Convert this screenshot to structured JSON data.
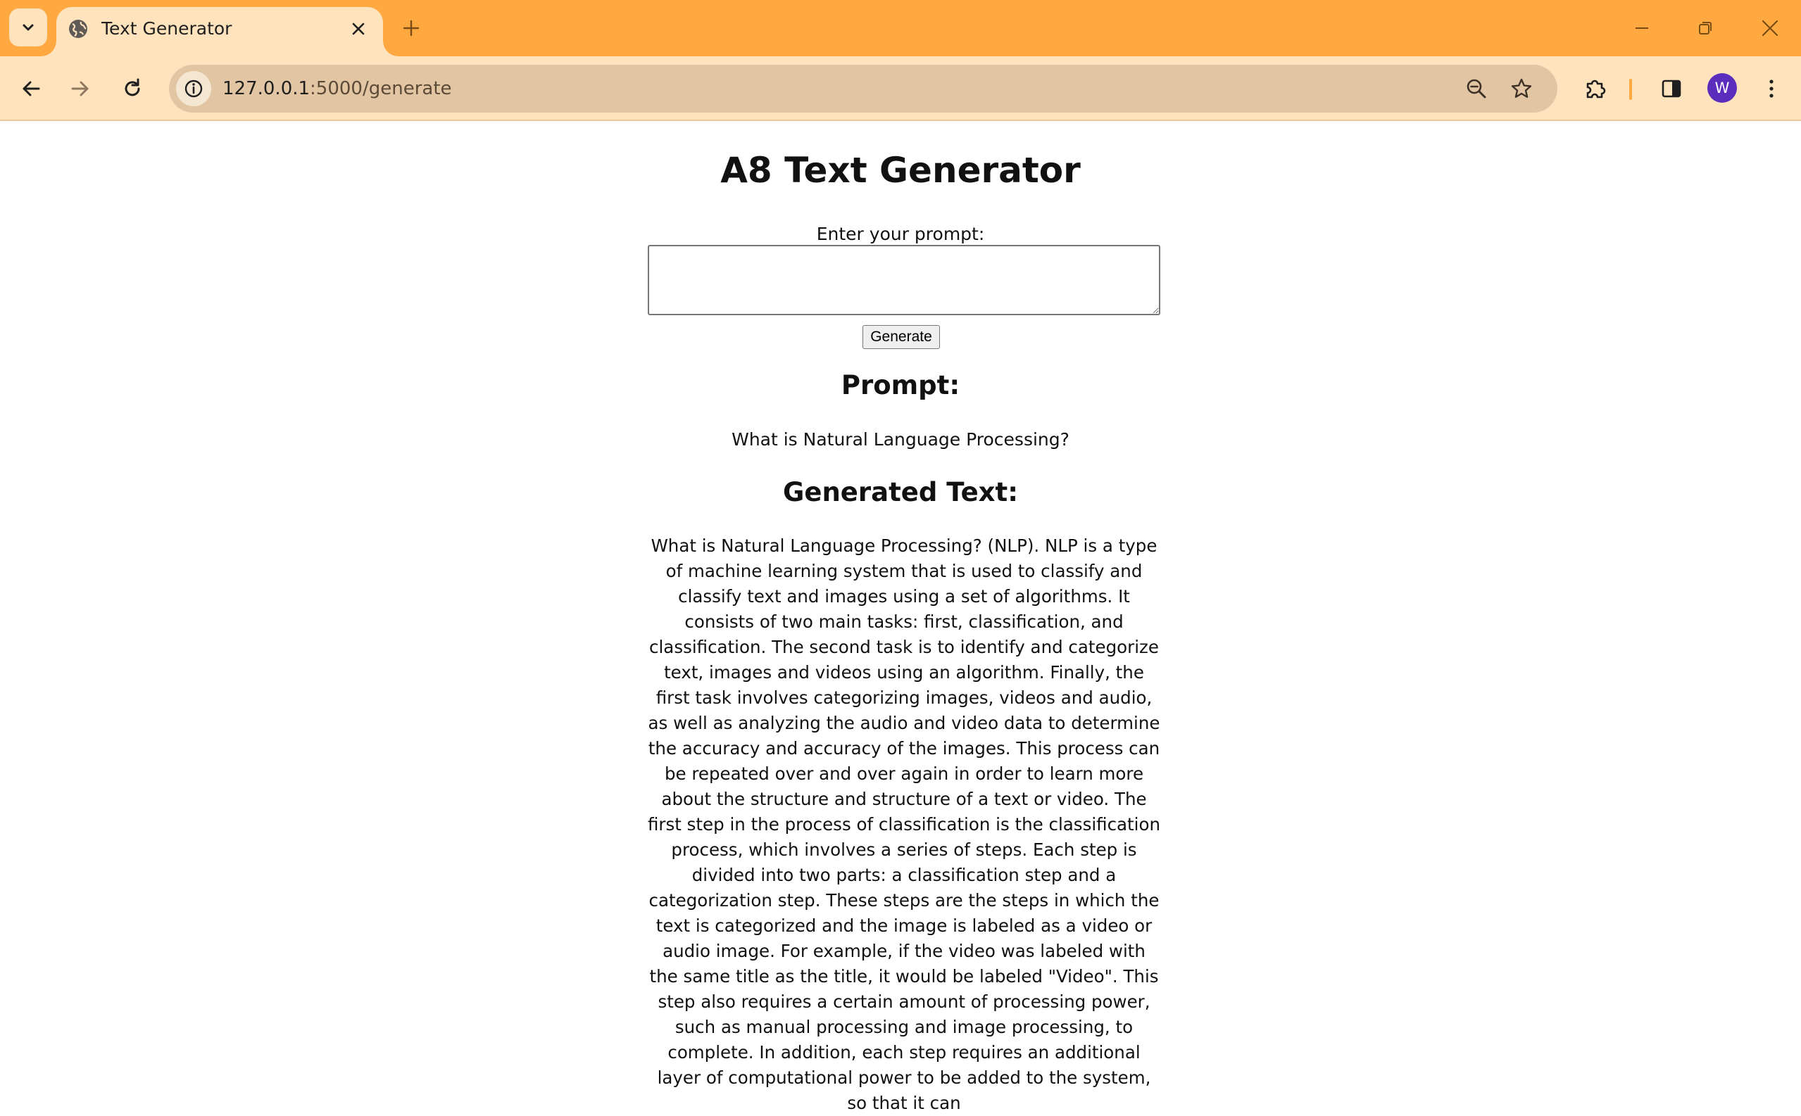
{
  "browser": {
    "tab": {
      "title": "Text Generator",
      "favicon": "globe-icon"
    },
    "url": {
      "host": "127.0.0.1",
      "path": ":5000/generate"
    },
    "profile_initial": "W",
    "colors": {
      "frame": "#FFA940",
      "toolbar": "#FFE3BD",
      "omnibox": "#E2C6A4",
      "avatar": "#5B2DBD"
    }
  },
  "page": {
    "title": "A8 Text Generator",
    "prompt_label": "Enter your prompt:",
    "prompt_value": "",
    "generate_label": "Generate",
    "prompt_heading": "Prompt:",
    "prompt_text": "What is Natural Language Processing?",
    "generated_heading": "Generated Text:",
    "generated_text": "What is Natural Language Processing? (NLP). NLP is a type of machine learning system that is used to classify and classify text and images using a set of algorithms. It consists of two main tasks: first, classification, and classification. The second task is to identify and categorize text, images and videos using an algorithm. Finally, the first task involves categorizing images, videos and audio, as well as analyzing the audio and video data to determine the accuracy and accuracy of the images. This process can be repeated over and over again in order to learn more about the structure and structure of a text or video. The first step in the process of classification is the classification process, which involves a series of steps. Each step is divided into two parts: a classification step and a categorization step. These steps are the steps in which the text is categorized and the image is labeled as a video or audio image. For example, if the video was labeled with the same title as the title, it would be labeled \"Video\". This step also requires a certain amount of processing power, such as manual processing and image processing, to complete. In addition, each step requires an additional layer of computational power to be added to the system, so that it can"
  }
}
